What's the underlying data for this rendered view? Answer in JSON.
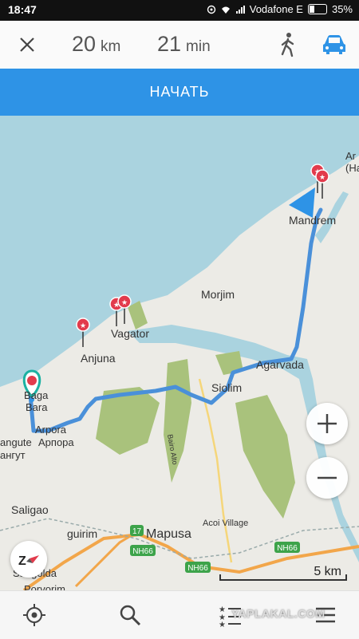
{
  "status_bar": {
    "time": "18:47",
    "carrier": "Vodafone E",
    "battery": "35%"
  },
  "route": {
    "distance_value": "20",
    "distance_unit": "km",
    "duration_value": "21",
    "duration_unit": "min",
    "modes": [
      "walk-icon",
      "car-icon"
    ],
    "active_mode": "car"
  },
  "start_button": {
    "label": "НАЧАТЬ"
  },
  "map": {
    "places": {
      "mandrem": "Mandrem",
      "morjim": "Morjim",
      "vagator": "Vagator",
      "anjuna": "Anjuna",
      "agarvada": "Agarvada",
      "siolim": "Siolim",
      "baga_1": "Baga",
      "baga_2": "Bara",
      "arpora": "Arpora",
      "arpora_ru": "Арпора",
      "calangute": "angute",
      "calangute_ru": "ангут",
      "saligao": "Saligao",
      "guirim": "guirim",
      "mapusa": "Mapusa",
      "acoi_village": "Acoi Village",
      "sangolda": "Sangolda",
      "porvorim": "Porvorim",
      "bairo_alto": "Bairo Alto",
      "north_partial_1": "Ar",
      "north_partial_2": "(Ha"
    },
    "roads": {
      "nh66_a": "NH66",
      "nh66_b": "NH66",
      "road_17": "17"
    },
    "zoom_in": "+",
    "zoom_out": "−",
    "scale": "5 km"
  },
  "colors": {
    "accent": "#2e93e6",
    "sea": "#aad3df",
    "land": "#ecebe6",
    "route": "#4a90d9",
    "pin": "#e23b4c",
    "forest": "#a9c27c"
  },
  "bottom_nav": {
    "items": [
      "location-icon",
      "search-icon",
      "favorites-icon",
      "menu-icon"
    ],
    "watermark": "YAPLAKAL.COM"
  }
}
